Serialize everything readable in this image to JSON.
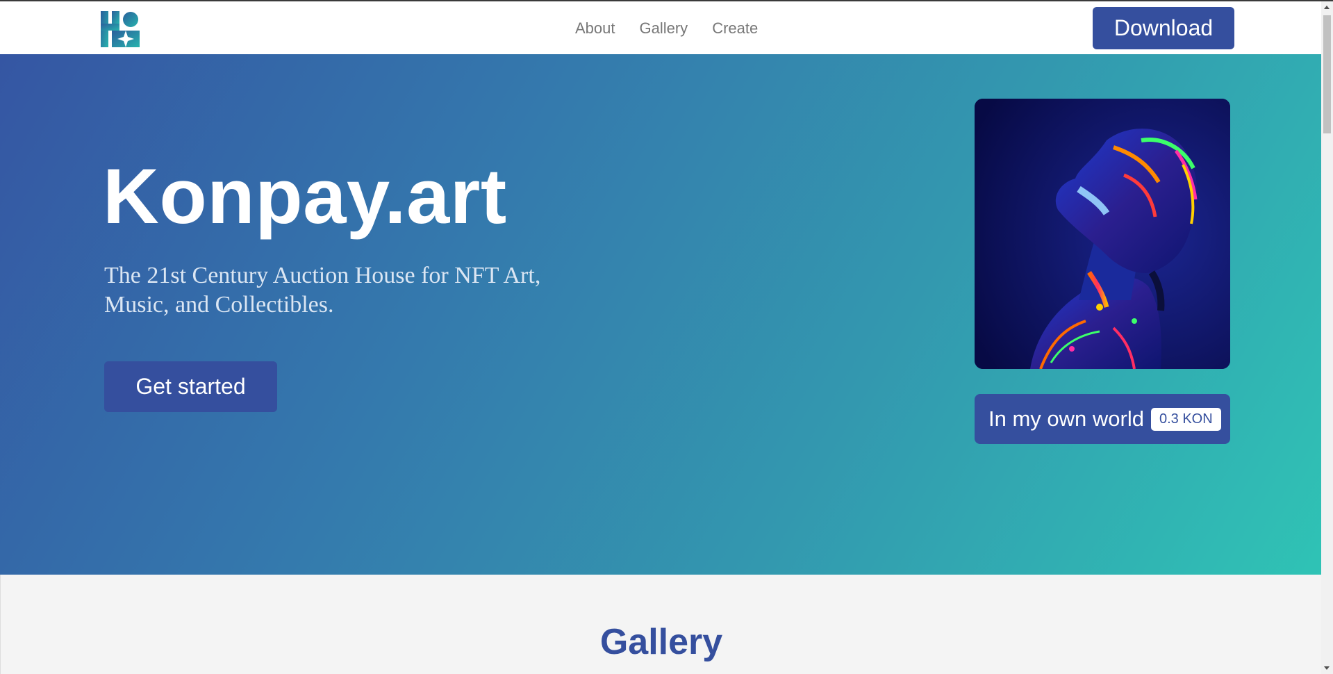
{
  "header": {
    "logo": "konpay-logo",
    "nav": [
      {
        "label": "About"
      },
      {
        "label": "Gallery"
      },
      {
        "label": "Create"
      }
    ],
    "download_label": "Download"
  },
  "hero": {
    "title": "Konpay.art",
    "subtitle": "The 21st Century Auction House for NFT Art, Music, and Collectibles.",
    "cta_label": "Get started",
    "featured": {
      "title": "In my own world",
      "price": "0.3 KON"
    }
  },
  "gallery": {
    "heading": "Gallery"
  },
  "colors": {
    "brand": "#354f9e",
    "gradient_start": "#3556a3",
    "gradient_end": "#2fc3b5",
    "section_bg": "#f4f4f4"
  }
}
